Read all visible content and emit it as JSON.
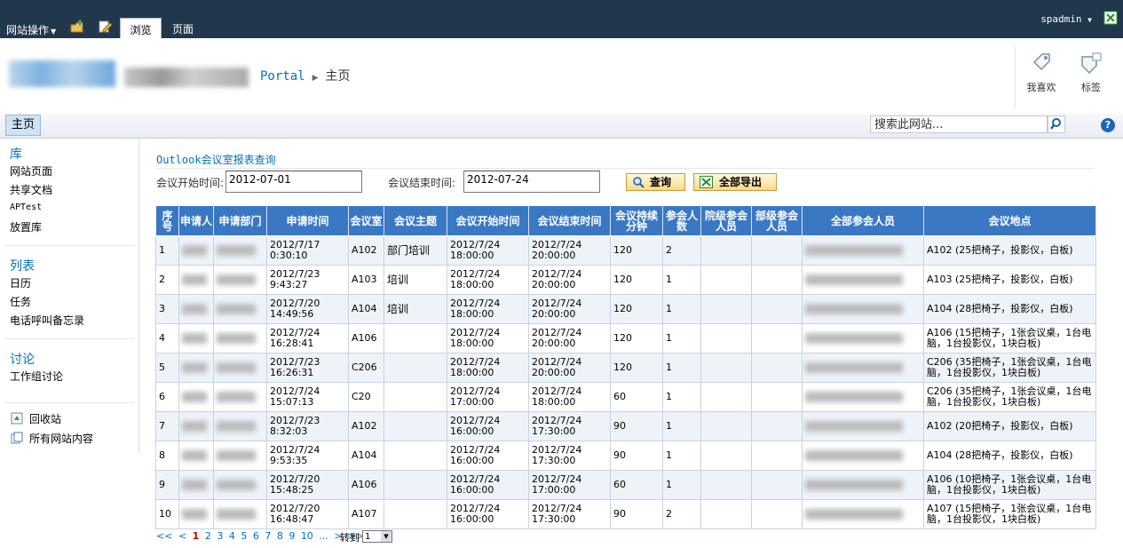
{
  "ribbon": {
    "site_actions": "网站操作",
    "tabs": [
      {
        "label": "浏览"
      },
      {
        "label": "页面"
      }
    ],
    "user": "spadmin"
  },
  "breadcrumb": {
    "root": "Portal",
    "current": "主页"
  },
  "title_buttons": {
    "like": "我喜欢",
    "tags": "标签"
  },
  "topnav": {
    "home": "主页",
    "search_placeholder": "搜索此网站..."
  },
  "quicklaunch": {
    "sections": [
      {
        "title": "库",
        "items": [
          "网站页面",
          "共享文档",
          "APTest",
          "放置库"
        ]
      },
      {
        "title": "列表",
        "items": [
          "日历",
          "任务",
          "电话呼叫备忘录"
        ]
      },
      {
        "title": "讨论",
        "items": [
          "工作组讨论"
        ]
      }
    ],
    "recycle_bin": "回收站",
    "all_content": "所有网站内容"
  },
  "report": {
    "title_prefix": "Outlook",
    "title_rest": "会议室报表查询",
    "start_label": "会议开始时间:",
    "start_value": "2012-07-01",
    "end_label": "会议结束时间:",
    "end_value": "2012-07-24",
    "query_button": "查询",
    "export_button": "全部导出"
  },
  "table": {
    "headers": [
      "序号",
      "申请人",
      "申请部门",
      "申请时间",
      "会议室",
      "会议主题",
      "会议开始时间",
      "会议结束时间",
      "会议持续分钟",
      "参会人数",
      "院级参会人员",
      "部级参会人员",
      "全部参会人员",
      "会议地点"
    ],
    "rows": [
      {
        "no": "1",
        "apply_time": "2012/7/17 0:30:10",
        "room": "A102",
        "topic": "部门培训",
        "start": "2012/7/24 18:00:00",
        "end": "2012/7/24 20:00:00",
        "minutes": "120",
        "count": "2",
        "location": "A102 (25把椅子，投影仪，白板)"
      },
      {
        "no": "2",
        "apply_time": "2012/7/23 9:43:27",
        "room": "A103",
        "topic": "培训",
        "start": "2012/7/24 18:00:00",
        "end": "2012/7/24 20:00:00",
        "minutes": "120",
        "count": "1",
        "location": "A103 (25把椅子，投影仪，白板)"
      },
      {
        "no": "3",
        "apply_time": "2012/7/20 14:49:56",
        "room": "A104",
        "topic": "培训",
        "start": "2012/7/24 18:00:00",
        "end": "2012/7/24 20:00:00",
        "minutes": "120",
        "count": "1",
        "location": "A104 (28把椅子，投影仪，白板)"
      },
      {
        "no": "4",
        "apply_time": "2012/7/24 16:28:41",
        "room": "A106",
        "topic": "",
        "start": "2012/7/24 18:00:00",
        "end": "2012/7/24 20:00:00",
        "minutes": "120",
        "count": "1",
        "location": "A106 (15把椅子，1张会议桌，1台电脑，1台投影仪，1块白板)"
      },
      {
        "no": "5",
        "apply_time": "2012/7/23 16:26:31",
        "room": "C206",
        "topic": "",
        "start": "2012/7/24 18:00:00",
        "end": "2012/7/24 20:00:00",
        "minutes": "120",
        "count": "1",
        "location": "C206 (35把椅子，1张会议桌，1台电脑，1台投影仪，1块白板)"
      },
      {
        "no": "6",
        "apply_time": "2012/7/24 15:07:13",
        "room": "C20",
        "topic": "",
        "start": "2012/7/24 17:00:00",
        "end": "2012/7/24 18:00:00",
        "minutes": "60",
        "count": "1",
        "location": "C206 (35把椅子，1张会议桌，1台电脑，1台投影仪，1块白板)"
      },
      {
        "no": "7",
        "apply_time": "2012/7/23 8:32:03",
        "room": "A102",
        "topic": "",
        "start": "2012/7/24 16:00:00",
        "end": "2012/7/24 17:30:00",
        "minutes": "90",
        "count": "1",
        "location": "A102 (20把椅子，投影仪，白板)"
      },
      {
        "no": "8",
        "apply_time": "2012/7/24 9:53:35",
        "room": "A104",
        "topic": "",
        "start": "2012/7/24 16:00:00",
        "end": "2012/7/24 17:30:00",
        "minutes": "90",
        "count": "1",
        "location": "A104 (28把椅子，投影仪，白板)"
      },
      {
        "no": "9",
        "apply_time": "2012/7/20 15:48:25",
        "room": "A106",
        "topic": "",
        "start": "2012/7/24 16:00:00",
        "end": "2012/7/24 17:00:00",
        "minutes": "60",
        "count": "1",
        "location": "A106 (10把椅子，1张会议桌，1台电脑，1台投影仪，1块白板)"
      },
      {
        "no": "10",
        "apply_time": "2012/7/20 16:48:47",
        "room": "A107",
        "topic": "",
        "start": "2012/7/24 16:00:00",
        "end": "2012/7/24 17:30:00",
        "minutes": "90",
        "count": "2",
        "location": "A107 (15把椅子，1张会议桌，1台电脑，1台投影仪，1块白板)"
      }
    ]
  },
  "pager": {
    "first": "<<",
    "prev": "<",
    "pages": [
      "1",
      "2",
      "3",
      "4",
      "5",
      "6",
      "7",
      "8",
      "9",
      "10",
      "..."
    ],
    "next": ">",
    "last": ">>",
    "goto_label": "转到",
    "goto_value": "1"
  },
  "colors": {
    "ribbon_bg": "#21374c",
    "header_bg": "#3b78c4",
    "link": "#0072bc",
    "row_alt": "#eef3fa"
  }
}
